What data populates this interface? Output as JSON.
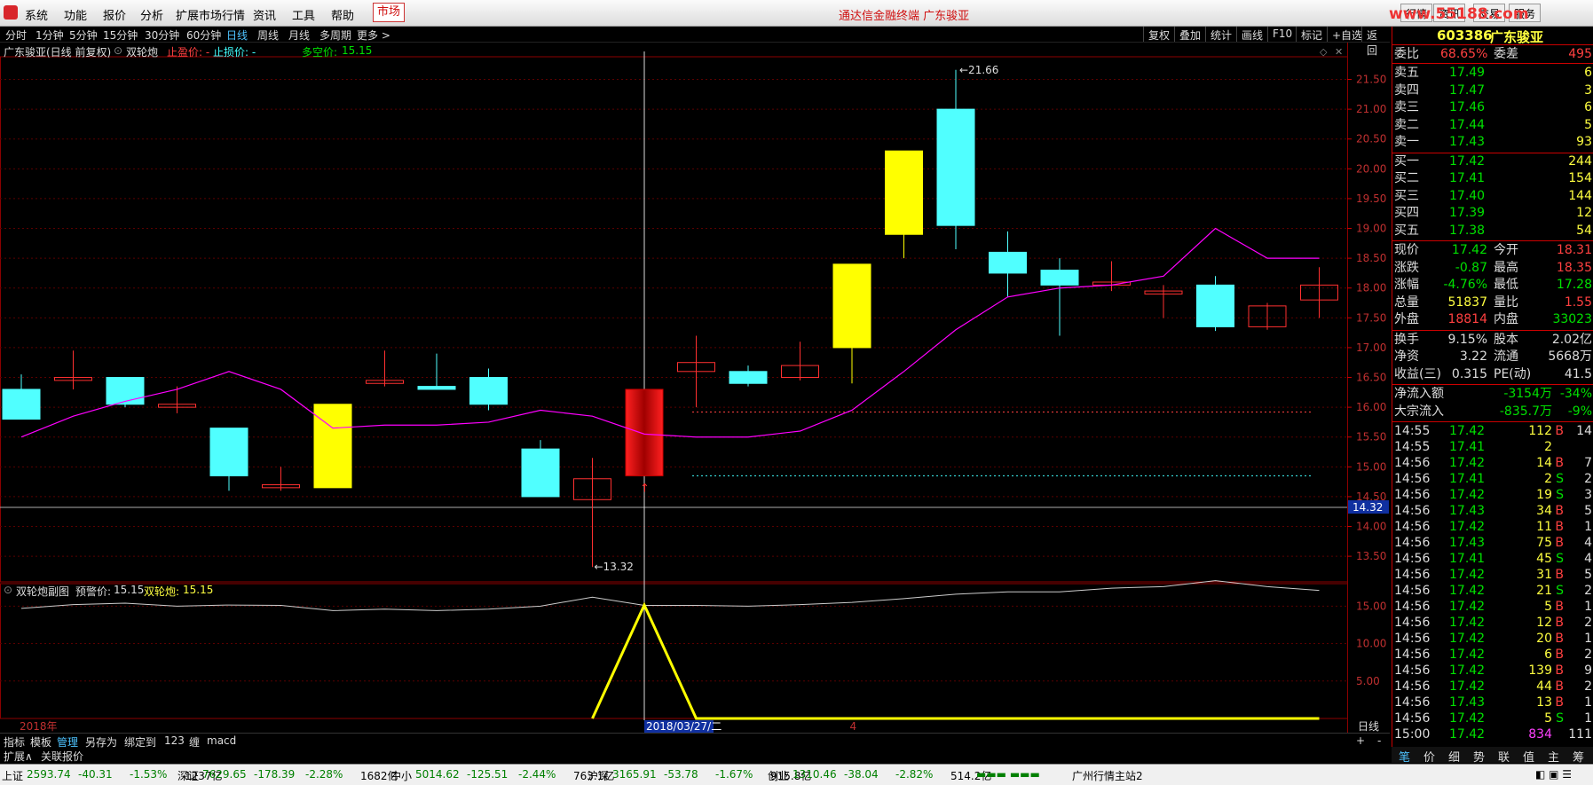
{
  "menubar": {
    "items": [
      "系统",
      "功能",
      "报价",
      "分析",
      "扩展市场行情",
      "资讯",
      "工具",
      "帮助"
    ],
    "market": "市场",
    "title": "通达信金融终端  广东骏亚",
    "right_buttons": [
      "行情",
      "资讯",
      "交易",
      "服务"
    ],
    "watermark": "www.55188.com"
  },
  "periods": [
    "分时",
    "1分钟",
    "5分钟",
    "15分钟",
    "30分钟",
    "60分钟",
    "日线",
    "周线",
    "月线",
    "多周期",
    "更多 >"
  ],
  "active_period": "日线",
  "chart_tools": [
    "复权",
    "叠加",
    "统计",
    "画线",
    "F10",
    "标记",
    "+自选",
    "返回"
  ],
  "chart_info": {
    "name": "广东骏亚(日线 前复权)",
    "indicator": "双轮炮",
    "stop_profit_label": "止盈价: -",
    "stop_loss_label": "止损价: -",
    "bull_bear_label": "多空价:",
    "bull_bear_value": "15.15"
  },
  "price_axis": [
    "21.50",
    "21.00",
    "20.50",
    "20.00",
    "19.50",
    "19.00",
    "18.50",
    "18.00",
    "17.50",
    "17.00",
    "16.50",
    "16.00",
    "15.50",
    "15.00",
    "14.50",
    "14.00",
    "13.50"
  ],
  "price_marker": "14.32",
  "high_label": "21.66",
  "low_label": "13.32",
  "sub_info": {
    "name": "双轮炮副图",
    "warn_label": "预警价:",
    "warn_value": "15.15",
    "ind_label": "双轮炮:",
    "ind_value": "15.15"
  },
  "sub_axis": [
    "15.00",
    "10.00",
    "5.00"
  ],
  "date_labels": {
    "year": "2018年",
    "cursor": "2018/03/27/二",
    "month": "4"
  },
  "period_label": "日线",
  "bottom_tabs": [
    "指标",
    "模板",
    "管理",
    "另存为",
    "绑定到",
    "123",
    "缠",
    "macd"
  ],
  "bottom_tabs2": [
    "扩展∧",
    "关联报价"
  ],
  "quote": {
    "code": "603386",
    "name": "广东骏亚",
    "weibi_label": "委比",
    "weibi": "68.65%",
    "weicha_label": "委差",
    "weicha": "495",
    "sells": [
      {
        "label": "卖五",
        "price": "17.49",
        "vol": "6"
      },
      {
        "label": "卖四",
        "price": "17.47",
        "vol": "3"
      },
      {
        "label": "卖三",
        "price": "17.46",
        "vol": "6"
      },
      {
        "label": "卖二",
        "price": "17.44",
        "vol": "5"
      },
      {
        "label": "卖一",
        "price": "17.43",
        "vol": "93"
      }
    ],
    "buys": [
      {
        "label": "买一",
        "price": "17.42",
        "vol": "244"
      },
      {
        "label": "买二",
        "price": "17.41",
        "vol": "154"
      },
      {
        "label": "买三",
        "price": "17.40",
        "vol": "144"
      },
      {
        "label": "买四",
        "price": "17.39",
        "vol": "12"
      },
      {
        "label": "买五",
        "price": "17.38",
        "vol": "54"
      }
    ],
    "stats": [
      {
        "l1": "现价",
        "v1": "17.42",
        "c1": "grn",
        "l2": "今开",
        "v2": "18.31",
        "c2": "red"
      },
      {
        "l1": "涨跌",
        "v1": "-0.87",
        "c1": "grn",
        "l2": "最高",
        "v2": "18.35",
        "c2": "red"
      },
      {
        "l1": "涨幅",
        "v1": "-4.76%",
        "c1": "grn",
        "l2": "最低",
        "v2": "17.28",
        "c2": "grn"
      },
      {
        "l1": "总量",
        "v1": "51837",
        "c1": "yel",
        "l2": "量比",
        "v2": "1.55",
        "c2": "red"
      },
      {
        "l1": "外盘",
        "v1": "18814",
        "c1": "red",
        "l2": "内盘",
        "v2": "33023",
        "c2": "grn"
      }
    ],
    "stats2": [
      {
        "l1": "换手",
        "v1": "9.15%",
        "l2": "股本",
        "v2": "2.02亿"
      },
      {
        "l1": "净资",
        "v1": "3.22",
        "l2": "流通",
        "v2": "5668万"
      },
      {
        "l1": "收益(三)",
        "v1": "0.315",
        "l2": "PE(动)",
        "v2": "41.5"
      }
    ],
    "flows": [
      {
        "label": "净流入额",
        "v1": "-3154万",
        "v2": "-34%"
      },
      {
        "label": "大宗流入",
        "v1": "-835.7万",
        "v2": "-9%"
      }
    ],
    "ticks": [
      [
        "14:55",
        "17.42",
        "112",
        "B",
        "14"
      ],
      [
        "14:55",
        "17.41",
        "2",
        "",
        ""
      ],
      [
        "14:56",
        "17.42",
        "14",
        "B",
        "7"
      ],
      [
        "14:56",
        "17.41",
        "2",
        "S",
        "2"
      ],
      [
        "14:56",
        "17.42",
        "19",
        "S",
        "3"
      ],
      [
        "14:56",
        "17.43",
        "34",
        "B",
        "5"
      ],
      [
        "14:56",
        "17.42",
        "11",
        "B",
        "1"
      ],
      [
        "14:56",
        "17.43",
        "75",
        "B",
        "4"
      ],
      [
        "14:56",
        "17.41",
        "45",
        "S",
        "4"
      ],
      [
        "14:56",
        "17.42",
        "31",
        "B",
        "5"
      ],
      [
        "14:56",
        "17.42",
        "21",
        "S",
        "2"
      ],
      [
        "14:56",
        "17.42",
        "5",
        "B",
        "1"
      ],
      [
        "14:56",
        "17.42",
        "12",
        "B",
        "2"
      ],
      [
        "14:56",
        "17.42",
        "20",
        "B",
        "1"
      ],
      [
        "14:56",
        "17.42",
        "6",
        "B",
        "2"
      ],
      [
        "14:56",
        "17.42",
        "139",
        "B",
        "9"
      ],
      [
        "14:56",
        "17.42",
        "44",
        "B",
        "2"
      ],
      [
        "14:56",
        "17.43",
        "13",
        "B",
        "1"
      ],
      [
        "14:56",
        "17.42",
        "5",
        "S",
        "1"
      ],
      [
        "15:00",
        "17.42",
        "834",
        "",
        "111"
      ]
    ]
  },
  "right_tabs": [
    "笔",
    "价",
    "细",
    "势",
    "联",
    "值",
    "主",
    "筹"
  ],
  "statusbar": [
    {
      "name": "上证",
      "v1": "2593.74",
      "v2": "-40.31",
      "v3": "-1.53%",
      "v4": "1237亿"
    },
    {
      "name": "深证",
      "v1": "7629.65",
      "v2": "-178.39",
      "v3": "-2.28%",
      "v4": "1682亿"
    },
    {
      "name": "中小",
      "v1": "5014.62",
      "v2": "-125.51",
      "v3": "-2.44%",
      "v4": "763.1亿"
    },
    {
      "name": "沪深",
      "v1": "3165.91",
      "v2": "-53.78",
      "v3": "-1.67%",
      "v4": "915.8亿"
    },
    {
      "name": "创业",
      "v1": "1310.46",
      "v2": "-38.04",
      "v3": "-2.82%",
      "v4": "514.2亿"
    }
  ],
  "server": "广州行情主站2",
  "chart_data": {
    "type": "candlestick",
    "candles": [
      {
        "o": 16.3,
        "c": 15.8,
        "h": 16.55,
        "l": 15.8
      },
      {
        "o": 16.45,
        "c": 16.5,
        "h": 16.95,
        "l": 16.3
      },
      {
        "o": 16.5,
        "c": 16.05,
        "h": 16.5,
        "l": 16.0
      },
      {
        "o": 16.0,
        "c": 16.05,
        "h": 16.35,
        "l": 15.9
      },
      {
        "o": 15.65,
        "c": 14.85,
        "h": 15.65,
        "l": 14.6
      },
      {
        "o": 14.65,
        "c": 14.7,
        "h": 15.0,
        "l": 14.6
      },
      {
        "o": 14.65,
        "c": 16.05,
        "h": 16.05,
        "l": 14.65
      },
      {
        "o": 16.4,
        "c": 16.45,
        "h": 16.95,
        "l": 16.35
      },
      {
        "o": 16.35,
        "c": 16.3,
        "h": 16.9,
        "l": 16.3
      },
      {
        "o": 16.5,
        "c": 16.05,
        "h": 16.65,
        "l": 15.95
      },
      {
        "o": 15.3,
        "c": 14.5,
        "h": 15.45,
        "l": 14.5
      },
      {
        "o": 14.45,
        "c": 14.8,
        "h": 15.15,
        "l": 13.32
      },
      {
        "o": 14.85,
        "c": 16.3,
        "h": 16.3,
        "l": 14.85
      },
      {
        "o": 16.6,
        "c": 16.75,
        "h": 17.2,
        "l": 16.0
      },
      {
        "o": 16.6,
        "c": 16.4,
        "h": 16.7,
        "l": 16.35
      },
      {
        "o": 16.5,
        "c": 16.7,
        "h": 17.1,
        "l": 16.45
      },
      {
        "o": 17.0,
        "c": 18.4,
        "h": 18.4,
        "l": 16.4
      },
      {
        "o": 18.9,
        "c": 20.3,
        "h": 20.3,
        "l": 18.5
      },
      {
        "o": 21.0,
        "c": 19.05,
        "h": 21.66,
        "l": 18.65
      },
      {
        "o": 18.6,
        "c": 18.25,
        "h": 18.95,
        "l": 17.85
      },
      {
        "o": 18.3,
        "c": 18.05,
        "h": 18.5,
        "l": 17.2
      },
      {
        "o": 18.05,
        "c": 18.1,
        "h": 18.45,
        "l": 17.95
      },
      {
        "o": 17.9,
        "c": 17.95,
        "h": 18.05,
        "l": 17.5
      },
      {
        "o": 18.05,
        "c": 17.35,
        "h": 18.2,
        "l": 17.28
      },
      {
        "o": 17.35,
        "c": 17.7,
        "h": 17.75,
        "l": 17.3
      },
      {
        "o": 17.8,
        "c": 18.05,
        "h": 18.35,
        "l": 17.5
      }
    ],
    "ma": [
      15.5,
      15.85,
      16.1,
      16.3,
      16.6,
      16.3,
      15.65,
      15.7,
      15.7,
      15.75,
      15.95,
      15.85,
      15.55,
      15.5,
      15.5,
      15.6,
      15.95,
      16.6,
      17.3,
      17.85,
      18.0,
      18.05,
      18.2,
      19.0,
      18.5,
      18.5
    ],
    "sub_white": [
      14.7,
      15.2,
      15.4,
      15.0,
      15.15,
      15.1,
      14.4,
      14.6,
      14.4,
      14.6,
      15.0,
      16.2,
      15.1,
      15.1,
      15.0,
      15.2,
      15.5,
      16.0,
      16.6,
      16.9,
      16.9,
      17.4,
      17.6,
      18.4,
      17.6,
      17.1
    ],
    "sub_yellow": [
      0,
      0,
      0,
      0,
      0,
      0,
      0,
      0,
      0,
      0,
      0,
      0,
      15.15,
      0,
      0,
      0,
      0,
      0,
      0,
      0,
      0,
      0,
      0,
      0,
      0,
      0
    ],
    "ylim": [
      13.1,
      21.85
    ],
    "sub_ylim": [
      0,
      18
    ],
    "cursor_index": 12,
    "stop_line1": 15.92,
    "stop_line2": 14.85,
    "price_line": 14.32
  }
}
